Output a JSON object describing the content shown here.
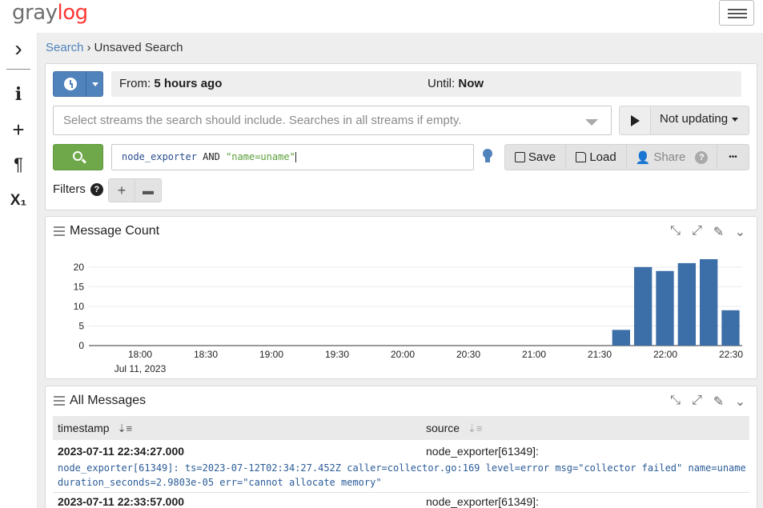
{
  "app": {
    "logo_gray": "gray",
    "logo_accent": "log"
  },
  "sidebar": {
    "items": [
      {
        "name": "expand",
        "glyph": "›"
      },
      {
        "name": "info",
        "glyph": "i"
      },
      {
        "name": "add",
        "glyph": "+"
      },
      {
        "name": "fields",
        "glyph": "¶"
      },
      {
        "name": "decorators",
        "glyph": "X₁"
      }
    ]
  },
  "breadcrumb": {
    "root": "Search",
    "separator": "›",
    "current": "Unsaved Search"
  },
  "timerange": {
    "from_label": "From:",
    "from_value": "5 hours ago",
    "until_label": "Until:",
    "until_value": "Now"
  },
  "streams": {
    "placeholder": "Select streams the search should include. Searches in all streams if empty."
  },
  "refresh": {
    "label": "Not updating"
  },
  "query": {
    "field": "node_exporter",
    "operator": "AND",
    "term": "\"name=uname\""
  },
  "actions": {
    "save": "Save",
    "load": "Load",
    "share": "Share",
    "help": "?",
    "more": "•••"
  },
  "filters": {
    "label": "Filters",
    "help": "?"
  },
  "message_count": {
    "title": "Message Count"
  },
  "chart_data": {
    "type": "bar",
    "title": "Message Count",
    "x_ticks": [
      "18:00",
      "18:30",
      "19:00",
      "19:30",
      "20:00",
      "20:30",
      "21:00",
      "21:30",
      "22:00",
      "22:30"
    ],
    "x_subtitle": "Jul 11, 2023",
    "y_ticks": [
      0,
      5,
      10,
      15,
      20
    ],
    "ylim": [
      0,
      22
    ],
    "categories": [
      "21:40",
      "21:50",
      "22:00",
      "22:10",
      "22:20",
      "22:30"
    ],
    "values": [
      4,
      20,
      19,
      21,
      22,
      9
    ],
    "color": "#3c6ea8",
    "grid": true
  },
  "all_messages": {
    "title": "All Messages",
    "columns": [
      "timestamp",
      "source"
    ],
    "rows": [
      {
        "timestamp": "2023-07-11 22:34:27.000",
        "source": "node_exporter[61349]:",
        "message": "node_exporter[61349]: ts=2023-07-12T02:34:27.452Z caller=collector.go:169 level=error msg=\"collector failed\" name=uname duration_seconds=2.9803e-05 err=\"cannot allocate memory\""
      },
      {
        "timestamp": "2023-07-11 22:33:57.000",
        "source": "node_exporter[61349]:",
        "message": ""
      }
    ]
  },
  "colors": {
    "primary": "#5082bc",
    "success": "#6fa84a",
    "bar": "#3c6ea8",
    "logo_accent": "#ff3633"
  }
}
